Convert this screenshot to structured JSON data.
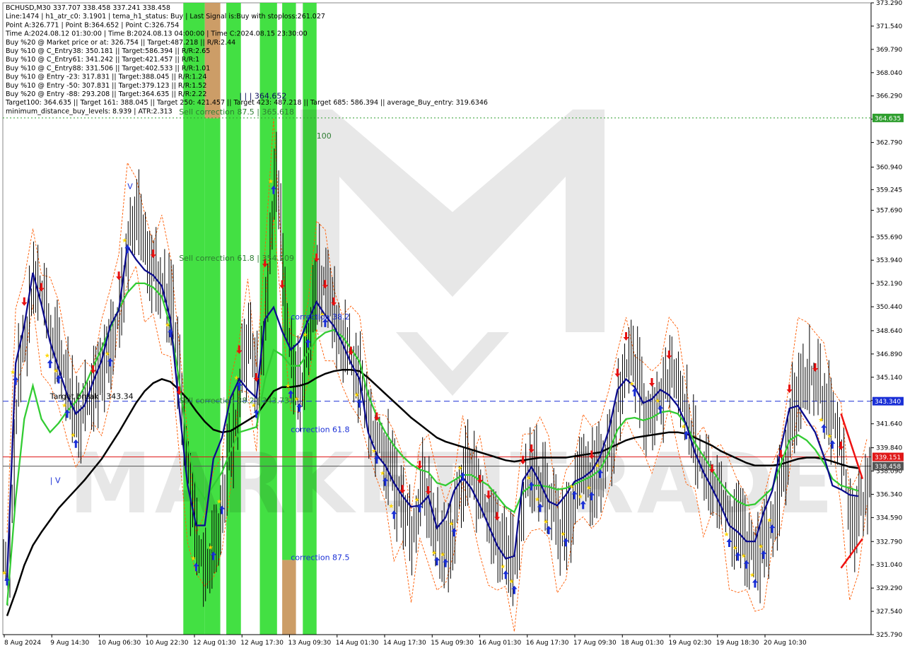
{
  "info_lines": [
    "BCHUSD,M30  337.707 338.458 337.241 338.458",
    "Line:1474 | h1_atr_c0: 3.1901 | tema_h1_status: Buy | Last Signal is:Buy with stoploss:261.027",
    "Point A:326.771 | Point B:364.652 | Point C:326.754",
    "Time A:2024.08.12 01:30:00 | Time B:2024.08.13 04:00:00 | Time C:2024.08.15 23:30:00",
    "Buy %20 @ Market price or at: 326.754 || Target:487.218 || R/R:2.44",
    "Buy %10 @ C_Entry38: 350.181 || Target:586.394 || R/R:2.65",
    "Buy %10 @ C_Entry61: 341.242 || Target:421.457 || R/R:1",
    "Buy %10 @ C_Entry88: 331.506 || Target:402.533 || R/R:1.01",
    "Buy %10 @ Entry -23: 317.831 || Target:388.045 || R/R:1.24",
    "Buy %10 @ Entry -50: 307.831 || Target:379.123 || R/R:1.52",
    "Buy %20 @ Entry -88: 293.208 || Target:364.635 || R/R:2.22",
    "Target100: 364.635 || Target 161: 388.045 || Target 250: 421.457 || Target 423: 487.218 || Target 685: 586.394 || average_Buy_entry: 319.6346",
    "minimum_distance_buy_levels: 8.939 | ATR:2.313"
  ],
  "chart_data": {
    "type": "line",
    "symbol": "BCHUSD",
    "timeframe": "M30",
    "ylim": [
      325.79,
      373.29
    ],
    "y_ticks": [
      "373.290",
      "371.540",
      "369.790",
      "368.040",
      "366.290",
      "364.540",
      "362.790",
      "360.940",
      "359.245",
      "357.690",
      "355.690",
      "353.940",
      "352.190",
      "350.440",
      "348.640",
      "346.890",
      "345.140",
      "343.390",
      "341.640",
      "339.840",
      "338.090",
      "336.340",
      "334.590",
      "332.790",
      "331.040",
      "329.290",
      "327.540",
      "325.790"
    ],
    "x_ticks": [
      "8 Aug 2024",
      "9 Aug 14:30",
      "10 Aug 06:30",
      "10 Aug 22:30",
      "12 Aug 01:30",
      "12 Aug 17:30",
      "13 Aug 09:30",
      "14 Aug 01:30",
      "14 Aug 17:30",
      "15 Aug 09:30",
      "16 Aug 01:30",
      "16 Aug 17:30",
      "17 Aug 09:30",
      "18 Aug 01:30",
      "19 Aug 02:30",
      "19 Aug 18:30",
      "20 Aug 10:30"
    ],
    "price_levels": [
      {
        "label": "364.635",
        "value": 364.635,
        "color": "#2e9e2e",
        "style": "dotted"
      },
      {
        "label": "343.340",
        "value": 343.34,
        "color": "#1a2fd6",
        "style": "dashed"
      },
      {
        "label": "339.151",
        "value": 339.151,
        "color": "#e01818",
        "style": "solid"
      },
      {
        "label": "338.458",
        "value": 338.458,
        "color": "#555555",
        "style": "solid"
      }
    ],
    "annotations": [
      {
        "text": "| | | 364.652",
        "price": 366.1,
        "color": "#0a0a5a",
        "i": 27
      },
      {
        "text": "Sell correction 87.5 | 365.618",
        "price": 364.9,
        "color": "#2e7d32",
        "i": 20
      },
      {
        "text": "100",
        "price": 363.1,
        "color": "#2e7d32",
        "i": 36
      },
      {
        "text": "Sell correction 61.8 | 354.209",
        "price": 353.9,
        "color": "#2e7d32",
        "i": 20
      },
      {
        "text": "correction 38.2",
        "price": 349.5,
        "color": "#1a2fd6",
        "i": 33
      },
      {
        "text": "Target break | 343.34",
        "price": 343.5,
        "color": "#000000",
        "i": 5
      },
      {
        "text": "Sell correction 38.2 | 343.731",
        "price": 343.2,
        "color": "#2e7d32",
        "i": 20
      },
      {
        "text": "correction 61.8",
        "price": 341.0,
        "color": "#1a2fd6",
        "i": 33
      },
      {
        "text": "correction 87.5",
        "price": 331.4,
        "color": "#1a2fd6",
        "i": 33
      },
      {
        "text": "V",
        "price": 359.3,
        "color": "#1a2fd6",
        "i": 14
      },
      {
        "text": "| V",
        "price": 337.2,
        "color": "#1a2fd6",
        "i": 5
      }
    ],
    "highlight_zones": [
      {
        "i0": 20.5,
        "i1": 23.0,
        "color": "#33dd33",
        "price_top": 373.29,
        "price_bottom": 325.79
      },
      {
        "i0": 23.0,
        "i1": 24.8,
        "color": "#c8955a",
        "price_top": 373.29,
        "price_bottom": 364.6
      },
      {
        "i0": 23.0,
        "i1": 24.8,
        "color": "#33dd33",
        "price_top": 364.6,
        "price_bottom": 325.79
      },
      {
        "i0": 25.5,
        "i1": 27.2,
        "color": "#33dd33",
        "price_top": 373.29,
        "price_bottom": 325.79
      },
      {
        "i0": 29.4,
        "i1": 31.4,
        "color": "#33dd33",
        "price_top": 373.29,
        "price_bottom": 325.79
      },
      {
        "i0": 32.0,
        "i1": 33.6,
        "color": "#33dd33",
        "price_top": 373.29,
        "price_bottom": 331.4
      },
      {
        "i0": 32.0,
        "i1": 33.6,
        "color": "#c8955a",
        "price_top": 331.4,
        "price_bottom": 325.79
      },
      {
        "i0": 34.4,
        "i1": 36.0,
        "color": "#33dd33",
        "price_top": 373.29,
        "price_bottom": 325.79
      }
    ],
    "close": [
      331.5,
      346,
      349,
      353.2,
      350.5,
      348,
      346.5,
      344,
      342,
      343,
      344.5,
      345.8,
      348,
      351.5,
      356.5,
      357.5,
      354.5,
      353,
      352,
      350,
      343,
      336,
      332,
      331,
      333,
      337,
      340.5,
      346,
      347.5,
      344,
      352,
      361,
      351,
      345.5,
      344.5,
      349,
      353,
      351,
      349.5,
      347.5,
      346,
      345,
      341.2,
      340.8,
      339,
      336.5,
      335,
      333.5,
      337,
      335.5,
      333,
      332.5,
      335,
      339,
      337.5,
      335.7,
      334.5,
      333,
      331.5,
      331,
      337.5,
      338.5,
      337,
      335.5,
      333.5,
      334,
      337.5,
      337,
      338,
      339,
      340.5,
      344,
      346.5,
      345.5,
      342,
      343,
      344,
      345,
      343.5,
      342,
      339,
      338,
      337,
      336,
      334.5,
      333.5,
      332.5,
      331.5,
      333,
      335,
      338.2,
      342.5,
      344.5,
      345.5,
      344.5,
      343,
      341.5,
      338.5,
      333.5,
      335.5,
      336.8
    ],
    "ema_fast": [
      330,
      346.2,
      349,
      353,
      350.6,
      347.8,
      345.8,
      343.8,
      342.4,
      343,
      344.8,
      346.4,
      349,
      350.2,
      355,
      354,
      353.2,
      352.8,
      352,
      349.5,
      343,
      337,
      334,
      334,
      339,
      340.6,
      343.6,
      345,
      344.2,
      343.6,
      349.5,
      350.4,
      348.6,
      347.2,
      347.8,
      349.4,
      350.8,
      349.8,
      349,
      347.7,
      346.2,
      345,
      341,
      339.3,
      338.5,
      337.2,
      336.2,
      335.4,
      335.5,
      336.2,
      333.8,
      334.6,
      336.6,
      337.6,
      336.8,
      335.5,
      334,
      332.5,
      331.5,
      331.7,
      337.4,
      338.4,
      337.2,
      335.8,
      335.5,
      336.3,
      337.3,
      337.6,
      338.1,
      339.2,
      341.2,
      344.2,
      345,
      344.4,
      343.2,
      343.5,
      344.2,
      343.8,
      343,
      341.6,
      339.5,
      338,
      336.8,
      335.5,
      334,
      333.5,
      332.8,
      332.8,
      335,
      336.6,
      339.8,
      342.8,
      343,
      342,
      341,
      339.2,
      337,
      336.7,
      336.3,
      336.2
    ],
    "ema_mid": [
      328,
      336,
      342,
      344.5,
      342,
      341,
      341.7,
      342.6,
      343.3,
      344.4,
      345.9,
      347.3,
      348.8,
      350.3,
      351.5,
      352.2,
      352.2,
      351.9,
      351.2,
      349,
      345,
      340,
      337,
      336,
      337,
      338,
      339.6,
      341,
      341.2,
      341.4,
      345,
      347.2,
      346.8,
      346,
      346,
      347,
      348,
      348.5,
      348.7,
      348.2,
      347.3,
      346.3,
      343.8,
      342.2,
      341,
      340,
      339.2,
      338.6,
      338.2,
      338,
      337.2,
      337,
      337.4,
      337.8,
      337.8,
      337.4,
      337,
      336.2,
      335.4,
      335,
      336.5,
      337,
      337,
      336.9,
      336.7,
      336.8,
      337.1,
      337.4,
      337.7,
      338.2,
      339.5,
      341.2,
      342,
      342.1,
      341.9,
      342.1,
      342.5,
      342.6,
      342.4,
      341.6,
      340.2,
      339.2,
      338.2,
      337.2,
      336.4,
      335.8,
      335.5,
      335.6,
      336.2,
      336.8,
      338.6,
      340.4,
      340.8,
      340.4,
      339.7,
      338.7,
      337.5,
      337,
      336.8,
      336.6
    ],
    "ema_slow": [
      327.2,
      329,
      331,
      332.5,
      333.5,
      334.4,
      335.3,
      336,
      336.7,
      337.4,
      338.2,
      339,
      340,
      341,
      342.1,
      343.2,
      344.1,
      344.7,
      345,
      344.8,
      344.2,
      343.5,
      342.6,
      341.8,
      341.2,
      341,
      341.1,
      341.5,
      341.9,
      342.3,
      343.2,
      344.1,
      344.4,
      344.4,
      344.5,
      344.7,
      345.1,
      345.4,
      345.6,
      345.7,
      345.7,
      345.6,
      345.1,
      344.5,
      343.9,
      343.3,
      342.7,
      342.1,
      341.6,
      341.1,
      340.6,
      340.3,
      340.1,
      339.9,
      339.7,
      339.5,
      339.3,
      339.1,
      338.9,
      338.8,
      338.9,
      339,
      339.1,
      339.1,
      339.1,
      339.1,
      339.2,
      339.3,
      339.4,
      339.5,
      339.8,
      340.1,
      340.4,
      340.6,
      340.7,
      340.8,
      340.9,
      341,
      341,
      340.9,
      340.6,
      340.3,
      340,
      339.6,
      339.3,
      339,
      338.7,
      338.5,
      338.5,
      338.5,
      338.6,
      338.8,
      339,
      339.1,
      339.1,
      339,
      338.8,
      338.6,
      338.4,
      338.3
    ],
    "buy_arrow_indices": [
      0,
      1,
      5,
      6,
      7,
      8,
      12,
      14,
      19,
      22,
      24,
      25,
      27,
      29,
      31,
      33,
      34,
      35,
      37,
      41,
      43,
      44,
      45,
      48,
      50,
      51,
      52,
      53,
      58,
      59,
      61,
      62,
      63,
      65,
      66,
      67,
      68,
      69,
      73,
      76,
      79,
      84,
      85,
      86,
      87,
      88,
      89,
      95,
      96
    ],
    "sell_arrow_indices": [
      2,
      4,
      10,
      13,
      17,
      20,
      27,
      29,
      30,
      32,
      36,
      37,
      38,
      40,
      43,
      46,
      48,
      49,
      55,
      56,
      57,
      60,
      61,
      68,
      71,
      72,
      75,
      77,
      82,
      90,
      91,
      94,
      97
    ],
    "red_diagonal_price_pairs": [
      [
        342.4,
        337.5
      ],
      [
        330.8,
        333.0
      ]
    ],
    "red_diagonal_indices": [
      [
        97.0,
        99.5
      ],
      [
        97.0,
        99.5
      ]
    ],
    "colors": {
      "ema_fast": "#0c0c8c",
      "ema_mid": "#33cc33",
      "ema_slow": "#000000",
      "bars": "#000000",
      "envelope": "#ff5a00",
      "buy_arrow": "#1a2fd6",
      "sell_arrow": "#e81010",
      "star": "#ffd700",
      "grid": "#c8c8c8"
    },
    "grid": false,
    "watermark": "MARKETITRADE"
  }
}
